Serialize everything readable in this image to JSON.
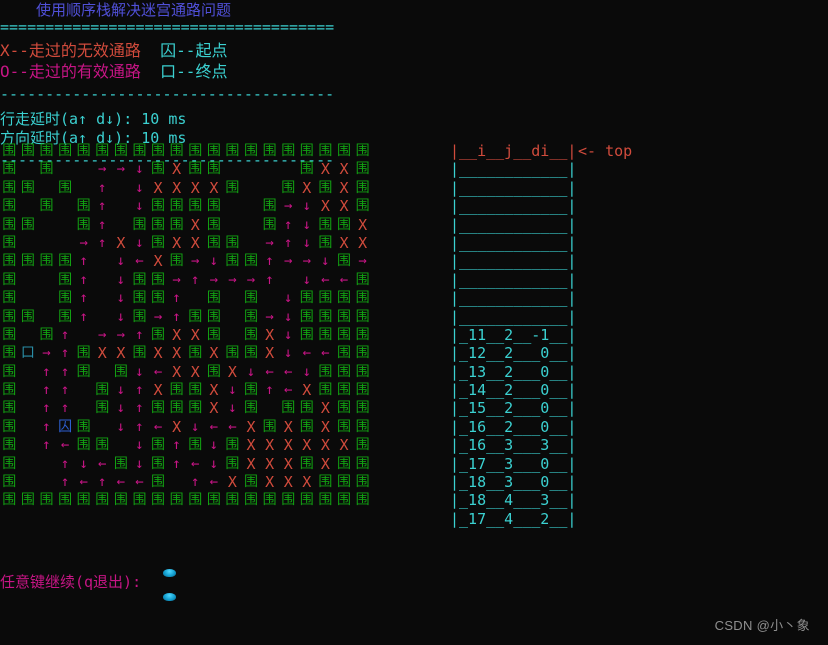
{
  "header": {
    "title": "使用顺序栈解决迷宫通路问题",
    "divider_double": "=====================================",
    "divider_single": "-------------------------------------",
    "legend": [
      {
        "left": "X--走过的无效通路",
        "left_kind": "x",
        "right": "囚--起点",
        "right_kind": "in"
      },
      {
        "left": "O--走过的有效通路",
        "left_kind": "o",
        "right": "口--终点",
        "right_kind": "in"
      }
    ],
    "delays": [
      {
        "label": "行走延时(a↑ d↓): ",
        "value": "10",
        "unit": " ms"
      },
      {
        "label": "方向延时(a↑ d↓): ",
        "value": "10",
        "unit": " ms"
      }
    ]
  },
  "maze": {
    "rows": 20,
    "cols": 20,
    "glyphs": {
      "wall": "围",
      "dead": "X",
      "start": "囚",
      "end": "口",
      "up": "↑",
      "down": "↓",
      "left": "←",
      "right": "→",
      "empty": " "
    },
    "colors": {
      "wall": "#12a012",
      "dead": "#d14b3c",
      "path": "#c71585",
      "start": "#2d5fd0",
      "end": "#2a8fa8",
      "background": "#0a0a0a"
    },
    "grid": [
      [
        "wall",
        "wall",
        "wall",
        "wall",
        "wall",
        "wall",
        "wall",
        "wall",
        "wall",
        "wall",
        "wall",
        "wall",
        "wall",
        "wall",
        "wall",
        "wall",
        "wall",
        "wall",
        "wall",
        "wall"
      ],
      [
        "wall",
        "empty",
        "wall",
        "empty",
        "empty",
        "right",
        "right",
        "down",
        "wall",
        "dead",
        "wall",
        "wall",
        "empty",
        "empty",
        "empty",
        "empty",
        "wall",
        "dead",
        "dead",
        "wall"
      ],
      [
        "wall",
        "wall",
        "empty",
        "wall",
        "empty",
        "up",
        "empty",
        "down",
        "dead",
        "dead",
        "dead",
        "dead",
        "wall",
        "empty",
        "empty",
        "wall",
        "dead",
        "wall",
        "dead",
        "wall"
      ],
      [
        "wall",
        "empty",
        "wall",
        "empty",
        "wall",
        "up",
        "empty",
        "down",
        "wall",
        "wall",
        "wall",
        "wall",
        "empty",
        "empty",
        "wall",
        "right",
        "down",
        "dead",
        "dead",
        "wall"
      ],
      [
        "wall",
        "wall",
        "empty",
        "empty",
        "wall",
        "up",
        "empty",
        "wall",
        "wall",
        "wall",
        "dead",
        "wall",
        "empty",
        "empty",
        "wall",
        "up",
        "down",
        "wall",
        "wall",
        "dead"
      ],
      [
        "wall",
        "empty",
        "empty",
        "empty",
        "right",
        "up",
        "dead",
        "down",
        "wall",
        "dead",
        "dead",
        "wall",
        "wall",
        "empty",
        "right",
        "up",
        "down",
        "wall",
        "dead",
        "dead"
      ],
      [
        "wall",
        "wall",
        "wall",
        "wall",
        "up",
        "empty",
        "down",
        "left",
        "dead",
        "wall",
        "right",
        "down",
        "wall",
        "wall",
        "up",
        "right",
        "right",
        "down",
        "wall",
        "right"
      ],
      [
        "wall",
        "empty",
        "empty",
        "wall",
        "up",
        "empty",
        "down",
        "wall",
        "wall",
        "right",
        "up",
        "right",
        "right",
        "right",
        "up",
        "empty",
        "down",
        "left",
        "left",
        "wall"
      ],
      [
        "wall",
        "empty",
        "empty",
        "wall",
        "up",
        "empty",
        "down",
        "wall",
        "wall",
        "up",
        "empty",
        "wall",
        "empty",
        "wall",
        "empty",
        "down",
        "wall",
        "wall",
        "wall",
        "wall"
      ],
      [
        "wall",
        "wall",
        "empty",
        "wall",
        "up",
        "empty",
        "down",
        "wall",
        "right",
        "up",
        "wall",
        "wall",
        "empty",
        "wall",
        "right",
        "down",
        "wall",
        "wall",
        "wall",
        "wall"
      ],
      [
        "wall",
        "empty",
        "wall",
        "up",
        "empty",
        "right",
        "right",
        "up",
        "wall",
        "dead",
        "dead",
        "wall",
        "empty",
        "wall",
        "dead",
        "down",
        "wall",
        "wall",
        "wall",
        "wall"
      ],
      [
        "wall",
        "end",
        "right",
        "up",
        "wall",
        "dead",
        "dead",
        "wall",
        "dead",
        "dead",
        "wall",
        "dead",
        "wall",
        "wall",
        "dead",
        "down",
        "left",
        "left",
        "wall",
        "wall"
      ],
      [
        "wall",
        "empty",
        "up",
        "up",
        "wall",
        "empty",
        "wall",
        "down",
        "left",
        "dead",
        "dead",
        "wall",
        "dead",
        "down",
        "left",
        "left",
        "down",
        "wall",
        "wall",
        "wall"
      ],
      [
        "wall",
        "empty",
        "up",
        "up",
        "empty",
        "wall",
        "down",
        "up",
        "dead",
        "wall",
        "wall",
        "dead",
        "down",
        "wall",
        "up",
        "left",
        "dead",
        "wall",
        "wall",
        "wall"
      ],
      [
        "wall",
        "empty",
        "up",
        "up",
        "empty",
        "wall",
        "down",
        "up",
        "wall",
        "wall",
        "wall",
        "dead",
        "down",
        "wall",
        "empty",
        "wall",
        "wall",
        "dead",
        "wall",
        "wall"
      ],
      [
        "wall",
        "empty",
        "up",
        "start",
        "wall",
        "empty",
        "down",
        "up",
        "left",
        "dead",
        "down",
        "left",
        "left",
        "dead",
        "wall",
        "dead",
        "wall",
        "dead",
        "wall",
        "wall"
      ],
      [
        "wall",
        "empty",
        "up",
        "left",
        "wall",
        "wall",
        "empty",
        "down",
        "wall",
        "up",
        "wall",
        "down",
        "wall",
        "dead",
        "dead",
        "dead",
        "dead",
        "dead",
        "dead",
        "wall"
      ],
      [
        "wall",
        "empty",
        "empty",
        "up",
        "down",
        "left",
        "wall",
        "down",
        "wall",
        "up",
        "left",
        "down",
        "wall",
        "dead",
        "dead",
        "dead",
        "wall",
        "dead",
        "wall",
        "wall"
      ],
      [
        "wall",
        "empty",
        "empty",
        "up",
        "left",
        "up",
        "left",
        "left",
        "wall",
        "empty",
        "up",
        "left",
        "dead",
        "wall",
        "dead",
        "dead",
        "dead",
        "wall",
        "wall",
        "wall"
      ],
      [
        "wall",
        "wall",
        "wall",
        "wall",
        "wall",
        "wall",
        "wall",
        "wall",
        "wall",
        "wall",
        "wall",
        "wall",
        "wall",
        "wall",
        "wall",
        "wall",
        "wall",
        "wall",
        "wall",
        "wall"
      ]
    ]
  },
  "stack": {
    "top_label": "<- top",
    "header": "|__i__j__di__|",
    "empty_row": "|____________|",
    "empty_count": 9,
    "columns": [
      "i",
      "j",
      "di"
    ],
    "entries": [
      {
        "i": "11",
        "j": "2",
        "di": "-1"
      },
      {
        "i": "12",
        "j": "2",
        "di": "0"
      },
      {
        "i": "13",
        "j": "2",
        "di": "0"
      },
      {
        "i": "14",
        "j": "2",
        "di": "0"
      },
      {
        "i": "15",
        "j": "2",
        "di": "0"
      },
      {
        "i": "16",
        "j": "2",
        "di": "0"
      },
      {
        "i": "16",
        "j": "3",
        "di": "3"
      },
      {
        "i": "17",
        "j": "3",
        "di": "0"
      },
      {
        "i": "18",
        "j": "3",
        "di": "0"
      },
      {
        "i": "18",
        "j": "4",
        "di": "3"
      },
      {
        "i": "17",
        "j": "4",
        "di": "2"
      }
    ]
  },
  "prompt": {
    "text": "任意键继续(q退出): "
  },
  "watermark": {
    "text": "CSDN @小丶象"
  }
}
